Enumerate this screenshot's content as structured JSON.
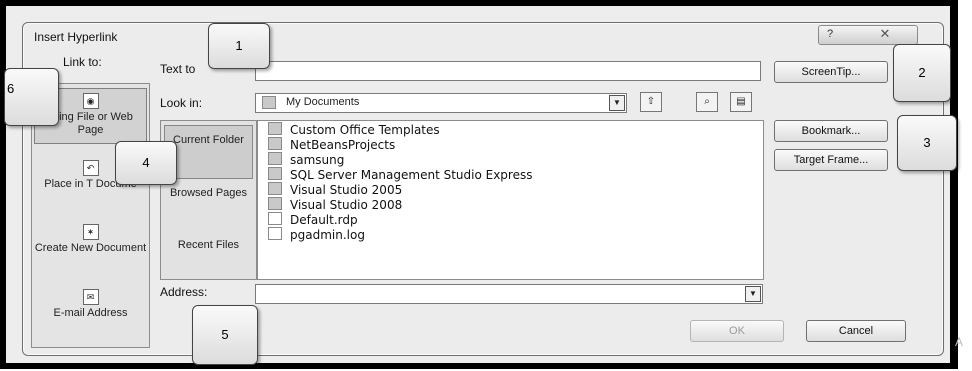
{
  "dialog": {
    "title": "Insert Hyperlink",
    "help_glyph": "?",
    "close_glyph": "✕"
  },
  "link_to": {
    "label": "Link to:",
    "items": [
      {
        "label": "Existing File or Web Page",
        "visible_text": "isting File or Web Page",
        "icon": "web-page-icon"
      },
      {
        "label": "Place in This Document",
        "visible_text": "Place in T Docume",
        "icon": "place-document-icon"
      },
      {
        "label": "Create New Document",
        "icon": "new-document-icon"
      },
      {
        "label": "E-mail Address",
        "icon": "email-icon"
      }
    ]
  },
  "text_to_display": {
    "label": "Text to",
    "value": ""
  },
  "look_in": {
    "label": "Look in:",
    "value": "My Documents"
  },
  "places": [
    {
      "label": "Current Folder"
    },
    {
      "label": "Browsed Pages",
      "visible_text": "Browsed Pages"
    },
    {
      "label": "Recent Files"
    }
  ],
  "files": [
    {
      "name": "Custom Office Templates",
      "type": "folder"
    },
    {
      "name": "NetBeansProjects",
      "type": "folder"
    },
    {
      "name": "samsung",
      "type": "folder"
    },
    {
      "name": "SQL Server Management Studio Express",
      "type": "folder"
    },
    {
      "name": "Visual Studio 2005",
      "type": "folder"
    },
    {
      "name": "Visual Studio 2008",
      "type": "folder"
    },
    {
      "name": "Default.rdp",
      "type": "file"
    },
    {
      "name": "pgadmin.log",
      "type": "file"
    }
  ],
  "address": {
    "label": "Address:",
    "value": ""
  },
  "buttons": {
    "screentip": "ScreenTip...",
    "bookmark": "Bookmark...",
    "target_frame": "Target Frame...",
    "ok": "OK",
    "cancel": "Cancel"
  },
  "callouts": [
    "1",
    "2",
    "3",
    "4",
    "5",
    "6"
  ],
  "watermark": "A"
}
